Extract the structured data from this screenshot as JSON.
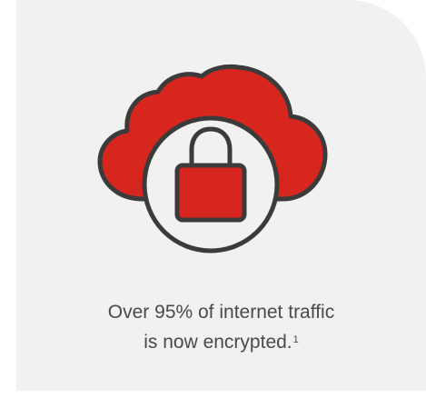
{
  "caption": {
    "line1": "Over 95% of internet traffic",
    "line2": "is now encrypted.",
    "footnote_marker": "1"
  },
  "icons": {
    "main": "cloud-with-padlock-icon"
  },
  "colors": {
    "card_background": "#f1f1f1",
    "cloud_red": "#d7261e",
    "outline": "#3b3b3b",
    "text": "#4a4a4a"
  }
}
